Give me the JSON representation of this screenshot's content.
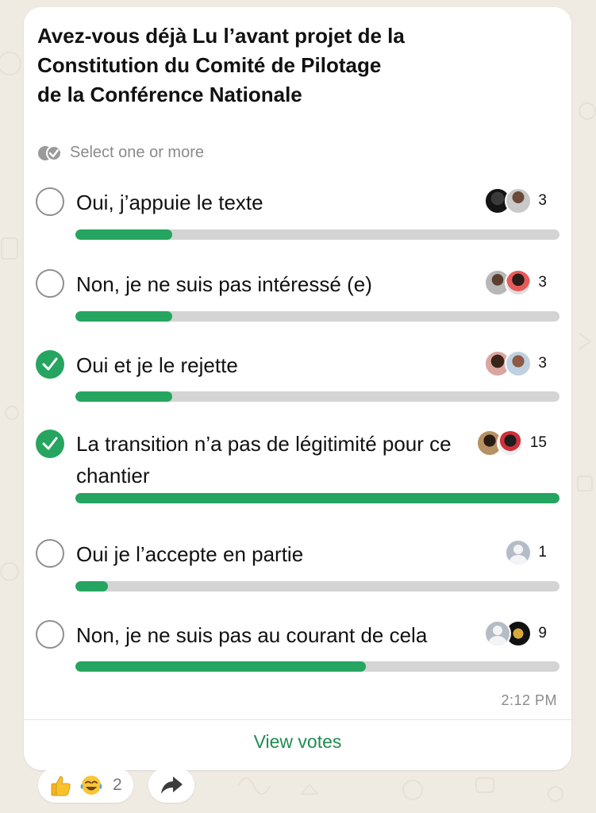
{
  "poll": {
    "question": "Avez-vous déjà Lu l’avant projet de la Constitution du Comité de Pilotage de la Conférence Nationale",
    "hint": "Select one or more",
    "options": [
      {
        "label": "Oui, j’appuie le texte",
        "votes": "3",
        "checked": false,
        "fill_fraction": 0.2
      },
      {
        "label": "Non, je ne suis pas intéressé (e)",
        "votes": "3",
        "checked": false,
        "fill_fraction": 0.2
      },
      {
        "label": "Oui et je le rejette",
        "votes": "3",
        "checked": true,
        "fill_fraction": 0.2
      },
      {
        "label": "La transition n’a pas de légitimité pour ce chantier",
        "votes": "15",
        "checked": true,
        "fill_fraction": 1.0
      },
      {
        "label": "Oui je l’accepte en partie",
        "votes": "1",
        "checked": false,
        "fill_fraction": 0.0667
      },
      {
        "label": "Non, je ne suis pas au courant de cela",
        "votes": "9",
        "checked": false,
        "fill_fraction": 0.6
      }
    ],
    "time": "2:12 PM",
    "view_votes_label": "View votes"
  },
  "reactions": {
    "emojis": [
      "thumbs-up-icon",
      "tears-of-joy-icon"
    ],
    "count": "2"
  },
  "colors": {
    "accent": "#25a55f",
    "link": "#1f8c52",
    "track": "#d4d4d4",
    "background": "#efeae2"
  }
}
